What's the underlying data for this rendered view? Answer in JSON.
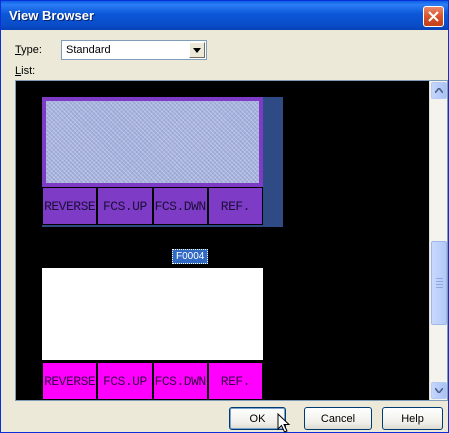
{
  "window": {
    "title": "View Browser"
  },
  "type_field": {
    "label_underlined": "T",
    "label_rest": "ype:",
    "value": "Standard"
  },
  "list_field": {
    "label_underlined": "L",
    "label_rest": "ist:"
  },
  "views": [
    {
      "id": "F0004",
      "selected": true,
      "screen_color": "#a7b3dd",
      "key_color": "#7e3bc6",
      "keys": [
        "REVERSE",
        "FCS.UP",
        "FCS.DWN",
        "REF."
      ]
    },
    {
      "id": "",
      "selected": false,
      "screen_color": "#ffffff",
      "key_color": "#ff00ff",
      "keys": [
        "REVERSE",
        "FCS.UP",
        "FCS.DWN",
        "REF."
      ]
    }
  ],
  "buttons": {
    "ok": "OK",
    "cancel": "Cancel",
    "help": "Help"
  },
  "icons": {
    "close": "close-icon",
    "dropdown": "chevron-down-icon",
    "scroll_up": "scroll-up-icon",
    "scroll_down": "scroll-down-icon",
    "cursor": "mouse-pointer-icon"
  },
  "colors": {
    "title_bar": "#0a5fe6",
    "list_background": "#000000",
    "selection": "#316ac5"
  }
}
